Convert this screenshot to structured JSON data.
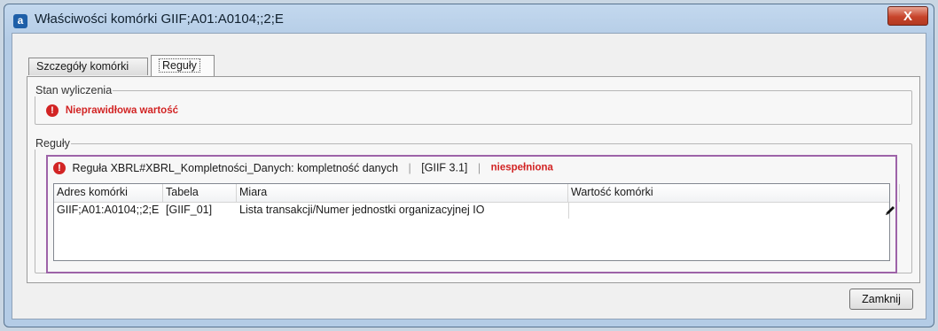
{
  "window": {
    "icon_glyph": "a",
    "title": "Właściwości komórki GIIF;A01:A0104;;2;E",
    "close_glyph": "X"
  },
  "tabs": [
    {
      "label": "Szczegóły komórki",
      "active": false
    },
    {
      "label": "Reguły",
      "active": true
    }
  ],
  "calculation_state": {
    "legend": "Stan wyliczenia",
    "icon": "error-icon",
    "status": "Nieprawidłowa wartość"
  },
  "rules": {
    "legend": "Reguły",
    "items": [
      {
        "icon": "error-icon",
        "title": "Reguła XBRL#XBRL_Kompletności_Danych: kompletność danych",
        "separator": "|",
        "code": "[GIIF 3.1]",
        "result": "niespełniona",
        "columns": [
          "Adres komórki",
          "Tabela",
          "Miara",
          "Wartość komórki"
        ],
        "rows": [
          {
            "address": "GIIF;A01:A0104;;2;E",
            "table": "[GIIF_01]",
            "measure": "Lista transakcji/Numer jednostki organizacyjnej IO",
            "value": "",
            "action_icon": "pencil-icon"
          }
        ]
      }
    ]
  },
  "footer": {
    "close_label": "Zamknij"
  },
  "colors": {
    "error": "#d22424",
    "rule_border": "#9d63a8",
    "titlebar": "#b4cce6",
    "close_red": "#c7442b"
  }
}
